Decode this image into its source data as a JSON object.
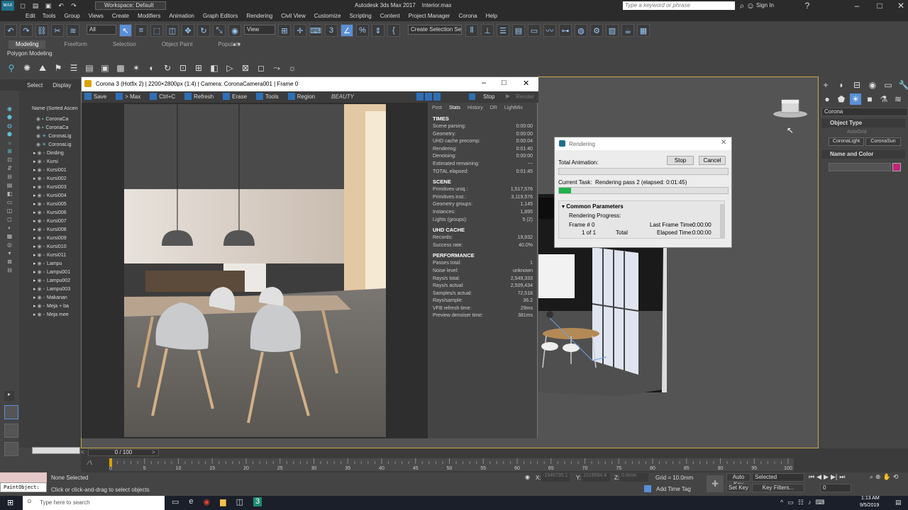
{
  "app": {
    "title": "Autodesk 3ds Max 2017",
    "file": "Interior.max",
    "workspace": "Workspace: Default",
    "search_placeholder": "Type a keyword or phrase",
    "sign_in": "Sign In",
    "logo": "MAX"
  },
  "menu": [
    "Edit",
    "Tools",
    "Group",
    "Views",
    "Create",
    "Modifiers",
    "Animation",
    "Graph Editors",
    "Rendering",
    "Civil View",
    "Customize",
    "Scripting",
    "Content",
    "Project Manager",
    "Corona",
    "Help"
  ],
  "toolbar": {
    "selection_filter": "All",
    "view_dropdown": "View",
    "create_selection_set": "Create Selection Se"
  },
  "ribbon": {
    "tabs": [
      "Modeling",
      "Freeform",
      "Selection",
      "Object Paint",
      "Populate"
    ],
    "subtitle": "Polygon Modeling"
  },
  "scene_explorer": {
    "tabs": [
      "Select",
      "Display"
    ],
    "header": "Name (Sorted Ascen",
    "items": [
      "CoronaCa",
      "CoronaCa",
      "CoronaLig",
      "CoronaLig",
      "Dinding",
      "Kursi",
      "Kursi001",
      "Kursi002",
      "Kursi003",
      "Kursi004",
      "Kursi005",
      "Kursi006",
      "Kursi007",
      "Kursi008",
      "Kursi009",
      "Kursi010",
      "Kursi011",
      "Lampu",
      "Lampu001",
      "Lampu002",
      "Lampu003",
      "Makanan",
      "Meja + ba",
      "Meja mee"
    ]
  },
  "vfb": {
    "title": "Corona 3 (Hotfix 2) | 2200×2800px (1:4) | Camera: CoronaCamera001 | Frame 0",
    "toolbar": [
      "Save",
      "> Max",
      "Ctrl+C",
      "Refresh",
      "Erase",
      "Tools",
      "Region"
    ],
    "pass": "BEAUTY",
    "stop": "Stop",
    "render": "Render",
    "tabs": [
      "Post",
      "Stats",
      "History",
      "DR",
      "LightMix"
    ],
    "sections": [
      {
        "title": "TIMES",
        "rows": [
          [
            "Scene parsing:",
            "0:00:00"
          ],
          [
            "Geometry:",
            "0:00:00"
          ],
          [
            "UHD cache precomp:",
            "0:00:04"
          ],
          [
            "Rendering:",
            "0:01:40"
          ],
          [
            "Denoising:",
            "0:00:00"
          ],
          [
            "Estimated remaining:",
            "---"
          ],
          [
            "TOTAL elapsed:",
            "0:01:45"
          ]
        ]
      },
      {
        "title": "SCENE",
        "rows": [
          [
            "Primitives uniq.:",
            "1,517,576"
          ],
          [
            "Primitives inst.:",
            "3,119,576"
          ],
          [
            "Geometry groups:",
            "1,145"
          ],
          [
            "Instances:",
            "1,895"
          ],
          [
            "Lights (groups):",
            "5 (2)"
          ]
        ]
      },
      {
        "title": "UHD CACHE",
        "rows": [
          [
            "Records:",
            "19,932"
          ],
          [
            "Success rate:",
            "40.0%"
          ]
        ]
      },
      {
        "title": "PERFORMANCE",
        "rows": [
          [
            "Passes total:",
            "1"
          ],
          [
            "Noise level:",
            "unknown"
          ],
          [
            "Rays/s total:",
            "2,549,333"
          ],
          [
            "Rays/s actual:",
            "2,509,434"
          ],
          [
            "Samples/s actual:",
            "72,518"
          ],
          [
            "Rays/sample:",
            "36.2"
          ],
          [
            "VFB refresh time:",
            "29ms"
          ],
          [
            "Preview denoiser time:",
            "381ms"
          ]
        ]
      }
    ]
  },
  "rendering_dialog": {
    "title": "Rendering",
    "total_animation": "Total Animation:",
    "stop": "Stop",
    "cancel": "Cancel",
    "current_task_label": "Current Task:",
    "current_task": "Rendering pass 2 (elapsed: 0:01:45)",
    "progress": 0.07,
    "common_parameters": "Common Parameters",
    "rendering_progress": "Rendering Progress:",
    "frame_label": "Frame #",
    "frame_value": "0",
    "frame_of": "1 of 1",
    "total": "Total",
    "last_frame_time_label": "Last Frame Time:",
    "last_frame_time": "0:00:00",
    "elapsed_time_label": "Elapsed Time:",
    "elapsed_time": "0:00:00"
  },
  "command_panel": {
    "category": "Corona",
    "object_type": "Object Type",
    "autogrid": "AutoGrid",
    "buttons": [
      "CoronaLight",
      "CoronaSun"
    ],
    "name_and_color": "Name and Color",
    "color": "#c2247a"
  },
  "timeline": {
    "frame": "0 / 100",
    "ticks": [
      "0",
      "5",
      "10",
      "15",
      "20",
      "25",
      "30",
      "35",
      "40",
      "45",
      "50",
      "55",
      "60",
      "65",
      "70",
      "75",
      "80",
      "85",
      "90",
      "95",
      "100"
    ]
  },
  "status": {
    "maxscript": "PaintObject:",
    "selection": "None Selected",
    "prompt": "Click or click-and-drag to select objects",
    "x": "X:",
    "x_val": "-1546735.1",
    "y": "Y:",
    "y_val": "1019594.4",
    "z": "Z:",
    "z_val": "0.0mm",
    "grid": "Grid = 10.0mm",
    "add_time_tag": "Add Time Tag",
    "auto_key": "Auto Key",
    "set_key": "Set Key",
    "selected": "Selected",
    "key_filters": "Key Filters...",
    "frame_field": "0"
  },
  "taskbar": {
    "search": "Type here to search",
    "time": "1:13 AM",
    "date": "9/5/2019"
  }
}
